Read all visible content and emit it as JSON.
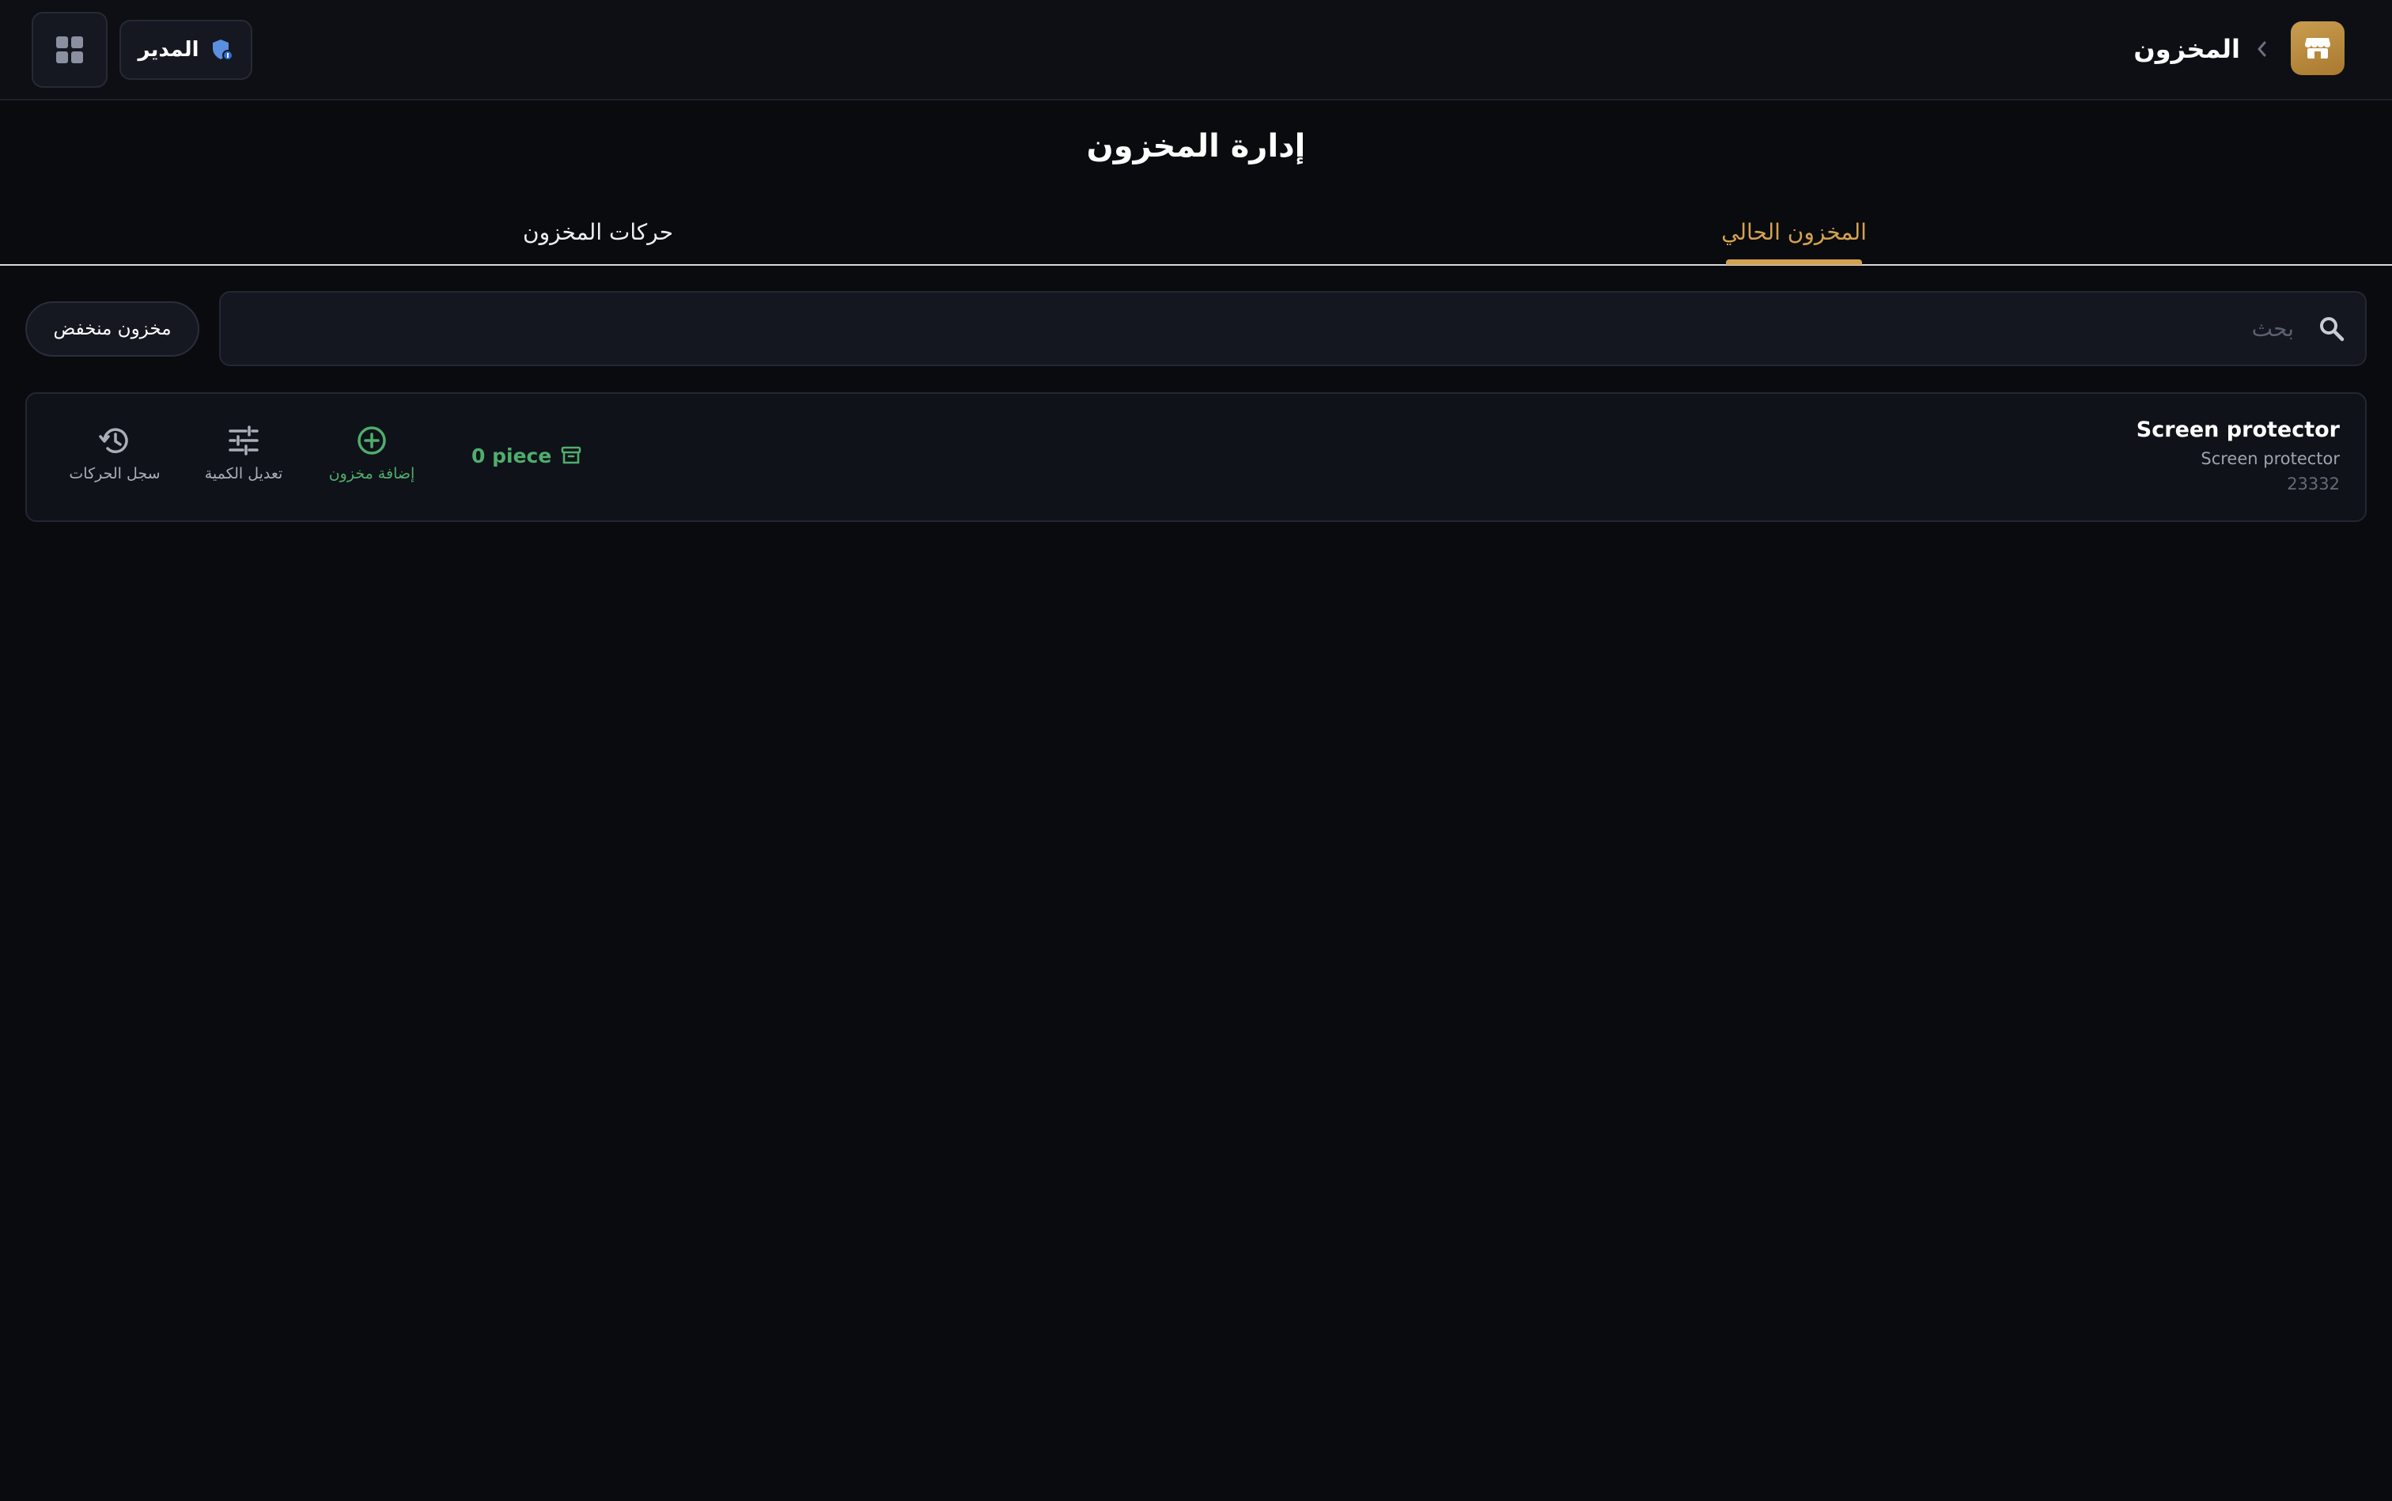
{
  "header": {
    "title": "المخزون",
    "role_label": "المدير",
    "brand_icon": "store-icon",
    "apps_icon": "grid-icon",
    "role_icon": "admin-shield-icon"
  },
  "page": {
    "title": "إدارة المخزون"
  },
  "tabs": [
    {
      "label": "المخزون الحالي",
      "active": true
    },
    {
      "label": "حركات المخزون",
      "active": false
    }
  ],
  "search": {
    "placeholder": "بحث",
    "value": ""
  },
  "filters": {
    "low_stock_label": "مخزون منخفض"
  },
  "items": [
    {
      "name": "Screen protector",
      "description": "Screen protector",
      "code": "23332",
      "quantity_text": "0 piece",
      "quantity": 0,
      "unit": "piece",
      "actions": {
        "add": "إضافة مخزون",
        "adjust": "تعديل الكمية",
        "history": "سجل الحركات"
      }
    }
  ],
  "colors": {
    "accent": "#d4a24e",
    "brand_icon_bg": "#b8893d",
    "positive": "#4fae6d",
    "background": "#0a0b0f"
  }
}
